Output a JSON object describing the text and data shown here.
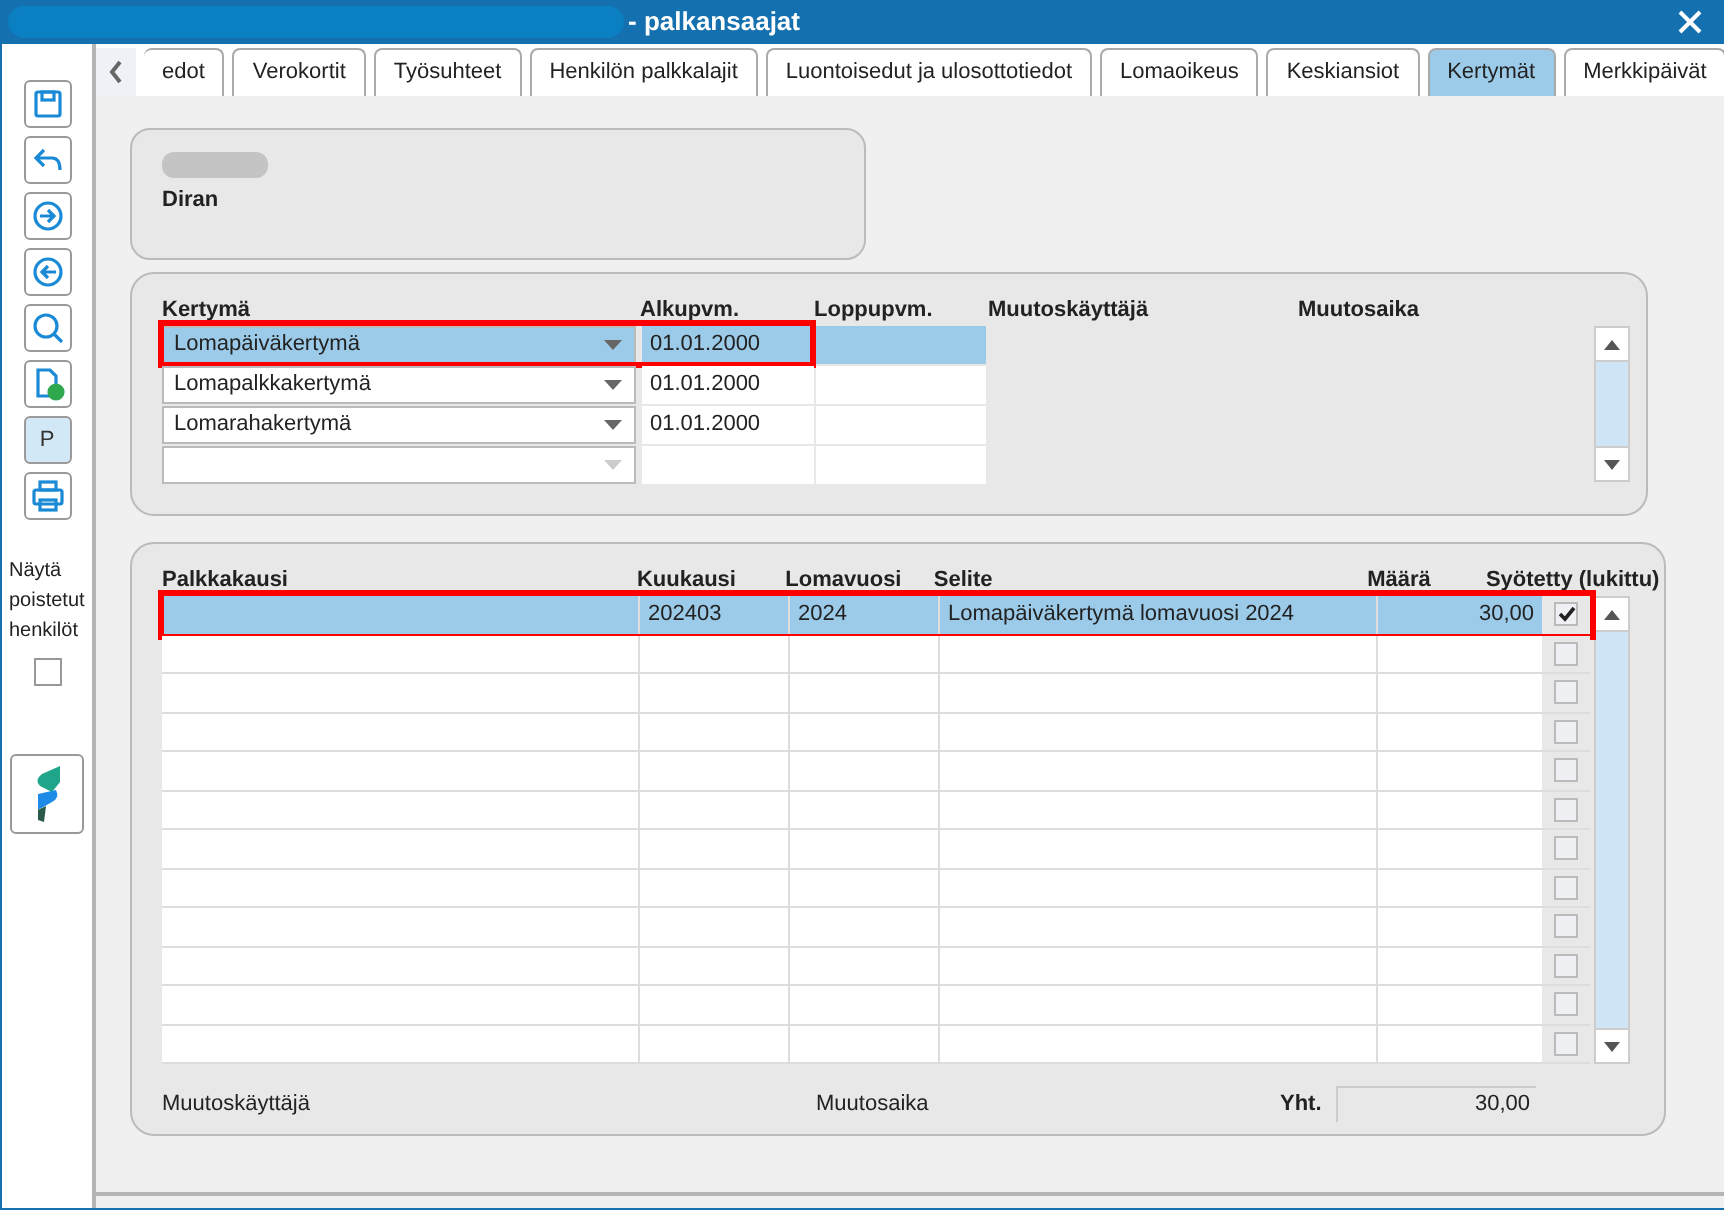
{
  "window": {
    "title": "- palkansaajat"
  },
  "toolbar": {
    "show_deleted_label": "Näytä poistetut henkilöt",
    "show_deleted_checked": false,
    "p_button": "P"
  },
  "tabs": [
    {
      "label": "edot",
      "selected": false
    },
    {
      "label": "Verokortit",
      "selected": false
    },
    {
      "label": "Työsuhteet",
      "selected": false
    },
    {
      "label": "Henkilön palkkalajit",
      "selected": false
    },
    {
      "label": "Luontoisedut ja ulosottotiedot",
      "selected": false
    },
    {
      "label": "Lomaoikeus",
      "selected": false
    },
    {
      "label": "Keskiansiot",
      "selected": false
    },
    {
      "label": "Kertymät",
      "selected": true
    },
    {
      "label": "Merkkipäivät",
      "selected": false
    }
  ],
  "person": {
    "name": "Diran"
  },
  "accruals": {
    "columns": [
      "Kertymä",
      "Alkupvm.",
      "Loppupvm.",
      "Muutoskäyttäjä",
      "Muutosaika"
    ],
    "rows": [
      {
        "type": "Lomapäiväkertymä",
        "start": "01.01.2000",
        "selected": true,
        "highlighted": true
      },
      {
        "type": "Lomapalkkakertymä",
        "start": "01.01.2000",
        "selected": false,
        "highlighted": false
      },
      {
        "type": "Lomarahakertymä",
        "start": "01.01.2000",
        "selected": false,
        "highlighted": false
      }
    ]
  },
  "entries": {
    "columns": [
      "Palkkakausi",
      "Kuukausi",
      "Lomavuosi",
      "Selite",
      "Määrä",
      "Syötetty (lukittu)"
    ],
    "rows": [
      {
        "month": "202403",
        "year": "2024",
        "description": "Lomapäiväkertymä lomavuosi 2024",
        "amount": "30,00",
        "locked": true,
        "selected": true,
        "highlighted": true
      },
      {
        "locked": false,
        "selected": false
      },
      {
        "locked": false,
        "selected": false
      },
      {
        "locked": false,
        "selected": false
      },
      {
        "locked": false,
        "selected": false
      },
      {
        "locked": false,
        "selected": false
      },
      {
        "locked": false,
        "selected": false
      },
      {
        "locked": false,
        "selected": false
      },
      {
        "locked": false,
        "selected": false
      },
      {
        "locked": false,
        "selected": false
      },
      {
        "locked": false,
        "selected": false
      },
      {
        "locked": false,
        "selected": false
      }
    ],
    "footer_user_label": "Muutoskäyttäjä",
    "footer_time_label": "Muutosaika",
    "total_label": "Yht.",
    "total": "30,00"
  }
}
